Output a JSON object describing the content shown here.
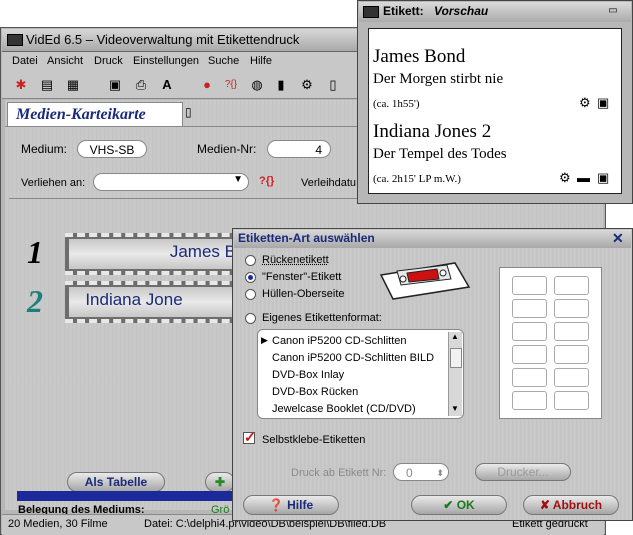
{
  "main_window": {
    "title": "VidEd 6.5 – Videoverwaltung mit Etikettendruck",
    "menu": [
      "Datei",
      "Ansicht",
      "Druck",
      "Einstellungen",
      "Suche",
      "Hilfe"
    ],
    "tab_label": "Medien-Karteikarte",
    "medium_label": "Medium:",
    "medium_value": "VHS-SB",
    "nr_label": "Medien-Nr:",
    "nr_value": "4",
    "verliehen_label": "Verliehen an:",
    "verleih_label": "Verleihdatu",
    "entries": [
      {
        "num": "1",
        "text": "James Bond - Der Morgen stirbt nie",
        "color": "#1a2a7a"
      },
      {
        "num": "2",
        "text": "Indiana Jone",
        "color": "#1f7f7f"
      }
    ],
    "als_tabelle": "Als Tabelle",
    "belegung_label": "Belegung des Mediums:",
    "belegung_text": "Grö",
    "status_left": "20 Medien, 30 Filme",
    "status_file": "Datei: C:\\delphi4.pr\\video\\DB\\beispiel\\DB\\filed.DB",
    "status_right": "Etikett gedruckt"
  },
  "preview_window": {
    "title_prefix": "Etikett:",
    "title_mode": "Vorschau",
    "items": [
      {
        "title": "James Bond",
        "subtitle": "Der Morgen stirbt nie",
        "meta": "(ca. 1h55')"
      },
      {
        "title": "Indiana Jones 2",
        "subtitle": "Der Tempel des Todes",
        "meta": "(ca. 2h15' LP m.W.)"
      }
    ]
  },
  "dialog": {
    "title": "Etiketten-Art auswählen",
    "radios": [
      "Rückenetikett",
      "\"Fenster\"-Etikett",
      "Hüllen-Oberseite",
      "Eigenes Etikettenformat:"
    ],
    "selected_radio": 1,
    "formats": [
      "Canon iP5200 CD-Schlitten",
      "Canon iP5200 CD-Schlitten BILD",
      "DVD-Box Inlay",
      "DVD-Box Rücken",
      "Jewelcase Booklet (CD/DVD)"
    ],
    "checkbox_label": "Selbstklebe-Etiketten",
    "checkbox_checked": true,
    "print_from_label": "Druck ab Etikett Nr:",
    "print_from_value": "0",
    "drucker_button": "Drucker...",
    "hilfe_button": "Hilfe",
    "ok_button": "OK",
    "abbruch_button": "Abbruch",
    "accent_red": "#cc1111"
  }
}
